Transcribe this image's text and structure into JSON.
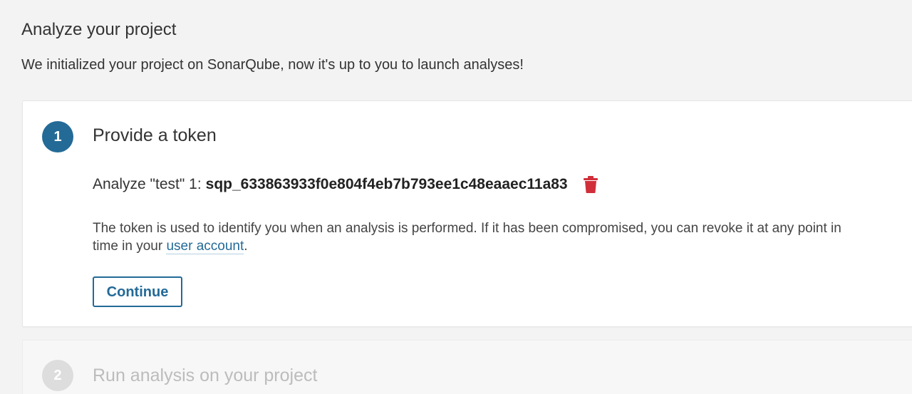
{
  "page": {
    "title": "Analyze your project",
    "description": "We initialized your project on SonarQube, now it's up to you to launch analyses!"
  },
  "step1": {
    "number": "1",
    "title": "Provide a token",
    "token": {
      "name": "Analyze \"test\" 1:",
      "value": "sqp_633863933f0e804f4eb7b793ee1c48eaaec11a83"
    },
    "help_text_before": "The token is used to identify you when an analysis is performed. If it has been compromised, you can revoke it at any point in time in your ",
    "help_link": "user account",
    "help_text_after": ".",
    "continue_label": "Continue",
    "delete_icon": "trash-icon"
  },
  "step2": {
    "number": "2",
    "title": "Run analysis on your project"
  },
  "colors": {
    "accent": "#236a97",
    "delete": "#d02f3a",
    "inactive_step": "#dddddd"
  }
}
